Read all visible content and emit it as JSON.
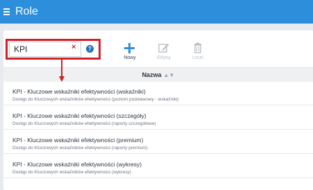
{
  "header": {
    "title": "Role"
  },
  "search": {
    "value": "KPI",
    "clear_symbol": "×",
    "help_symbol": "?"
  },
  "toolbar": {
    "new_label": "Nowy",
    "edit_label": "Edytuj",
    "delete_label": "Usuń"
  },
  "table": {
    "column_name": "Nazwa",
    "sort_symbol": "▲▼",
    "rows": [
      {
        "title": "KPI - Kluczowe wskaźniki efektywności (wskaźniki)",
        "desc": "Dostęp do Kluczowych wskaźników efektywności (poziom podstawowy - wskaźniki)"
      },
      {
        "title": "KPI - Kluczowe wskaźniki efektywności (szczegóły)",
        "desc": "Dostęp do Kluczowych wskaźników efektywności (raporty szczegółowe)"
      },
      {
        "title": "KPI - Kluczowe wskaźniki efektywności (premium)",
        "desc": "Dostęp do Kluczowych wskaźników efektywności (raporty premium)"
      },
      {
        "title": "KPI - Kluczowe wskaźniki efektywności (wykresy)",
        "desc": "Dostęp do Kluczowych wskaźników efektywności (wykresy)"
      }
    ]
  },
  "colors": {
    "header_bg": "#2d8fdc",
    "highlight_red": "#d32027",
    "primary_blue": "#2d8fdc"
  }
}
